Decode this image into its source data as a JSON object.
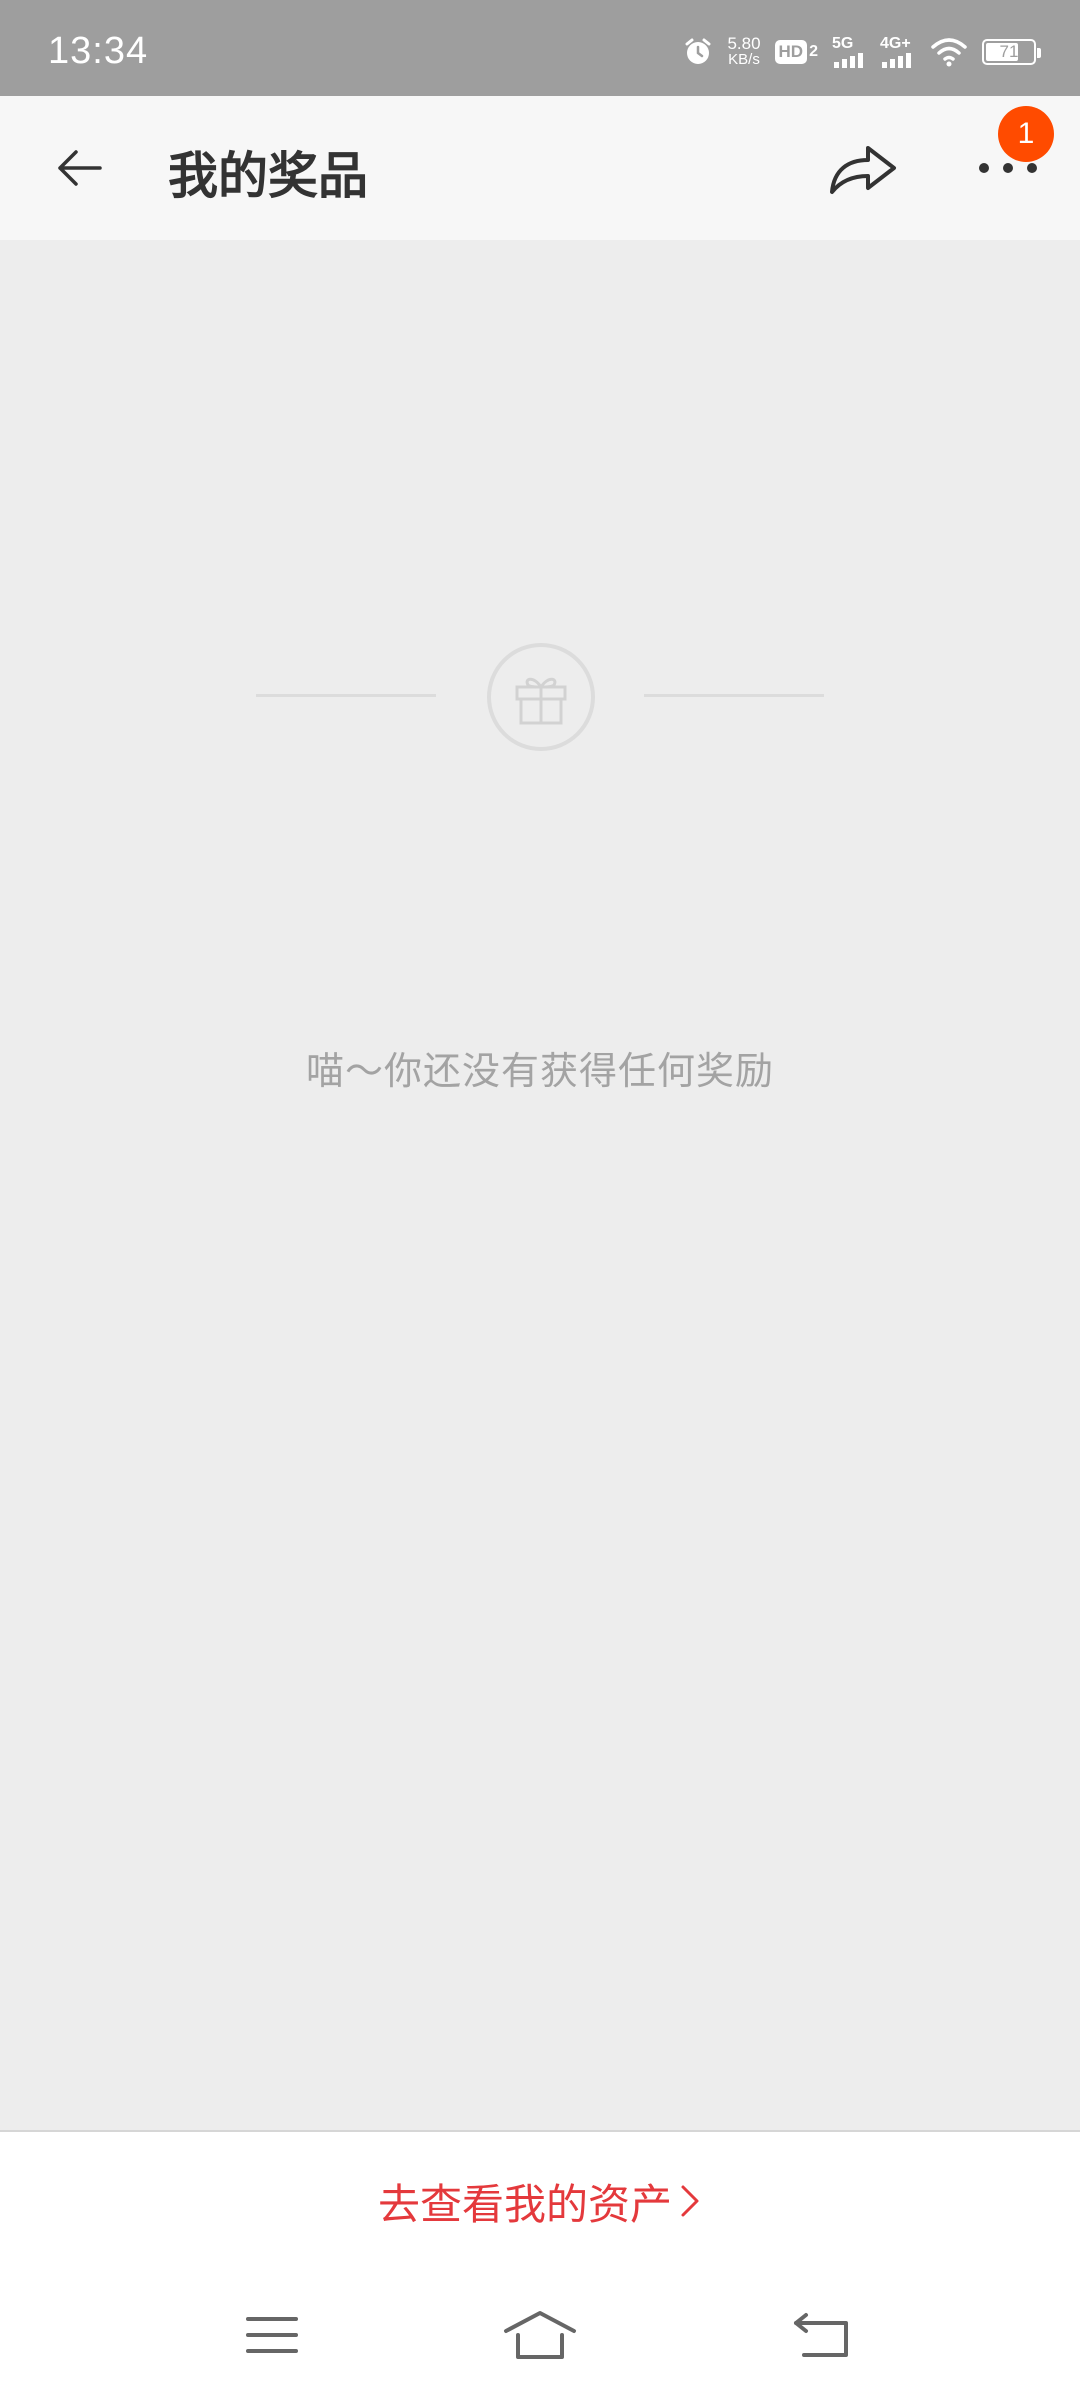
{
  "status_bar": {
    "time": "13:34",
    "net_speed_value": "5.80",
    "net_speed_unit": "KB/s",
    "hd_label": "HD",
    "hd_sub": "2",
    "sig1_label": "5G",
    "sig2_label": "4G+",
    "battery_percent": "71",
    "battery_level": 0.71,
    "icons": [
      "alarm-icon",
      "hd-icon",
      "signal-5g-icon",
      "signal-4g-icon",
      "wifi-icon",
      "battery-icon"
    ]
  },
  "header": {
    "title": "我的奖品",
    "back_icon": "arrow-left-icon",
    "share_icon": "share-icon",
    "more_icon": "more-dots-icon",
    "notification_count": "1",
    "badge_color": "#ff4b00"
  },
  "empty_state": {
    "icon": "gift-icon",
    "message": "喵～你还没有获得任何奖励"
  },
  "bottom_action": {
    "label": "去查看我的资产",
    "accent_color": "#e4393c",
    "icon": "chevron-right-icon"
  },
  "nav_bar": {
    "icons": [
      "menu-icon",
      "home-icon",
      "back-icon"
    ]
  }
}
